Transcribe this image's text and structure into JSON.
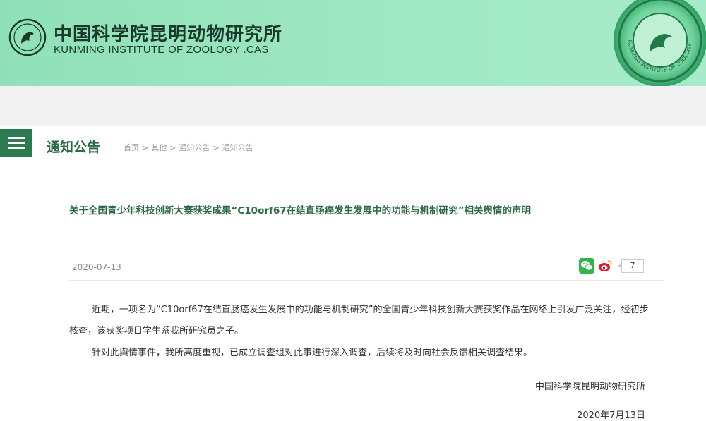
{
  "header": {
    "cn_title": "中国科学院昆明动物研究所",
    "en_title": "KUNMING INSTITUTE OF ZOOLOGY .CAS",
    "seal_text": "KUNMING INSTITUTE OF ZOOLOGY"
  },
  "nav": {
    "section_title": "通知公告",
    "breadcrumb": [
      "首页",
      "其他",
      "通知公告",
      "通知公告"
    ],
    "breadcrumb_sep": ">"
  },
  "article": {
    "title": "关于全国青少年科技创新大赛获奖成果“C10orf67在结直肠癌发生发展中的功能与机制研究”相关舆情的声明",
    "date": "2020-07-13",
    "share_count": "7",
    "paragraphs": [
      "近期，一项名为“C10orf67在结直肠癌发生发展中的功能与机制研究”的全国青少年科技创新大赛获奖作品在网络上引发广泛关注，经初步核查，该获奖项目学生系我所研究员之子。",
      "针对此舆情事件，我所高度重视，已成立调查组对此事进行深入调查，后续将及时向社会反馈相关调查结果。"
    ],
    "signature": "中国科学院昆明动物研究所",
    "signature_date": "2020年7月13日"
  },
  "icons": [
    "institute-logo-icon",
    "menu-icon",
    "wechat-icon",
    "weibo-icon",
    "seal-emblem-icon"
  ],
  "colors": {
    "header_green": "#9ee7c3",
    "brand_dark_green": "#2c7a4f",
    "title_green": "#2c6a46"
  }
}
